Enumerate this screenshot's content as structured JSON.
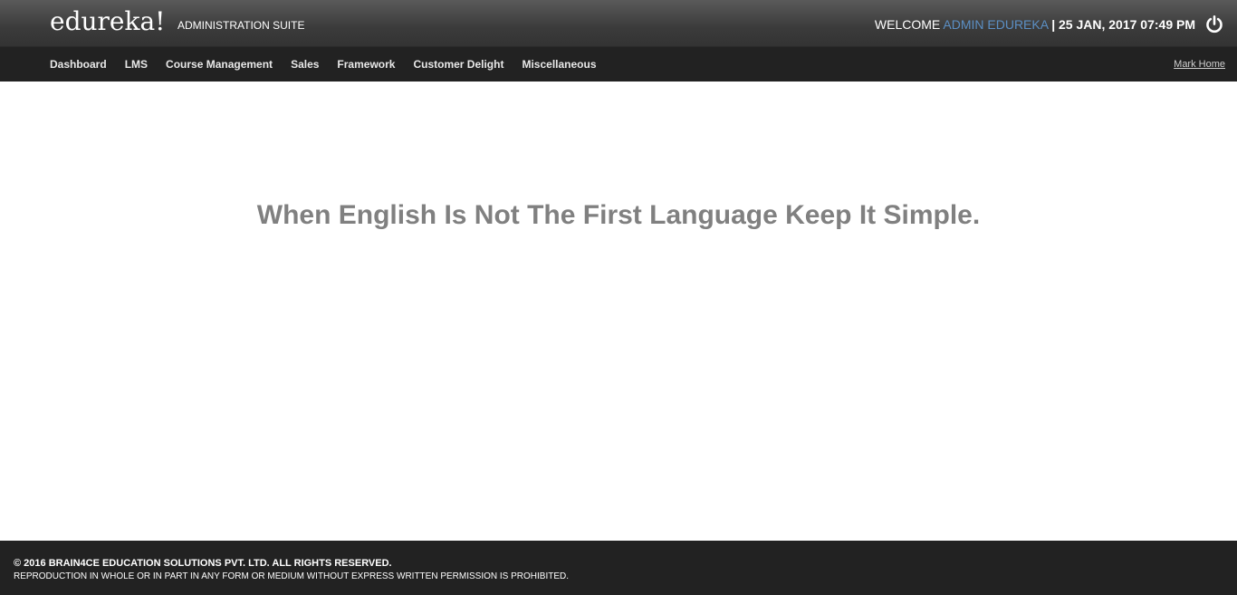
{
  "header": {
    "logo": "edureka!",
    "suite": "ADMINISTRATION SUITE",
    "welcome_label": "WELCOME",
    "user": "ADMIN EDUREKA",
    "datetime": "| 25 JAN, 2017 07:49 PM",
    "power_icon": "power-icon"
  },
  "nav": {
    "items": [
      {
        "label": "Dashboard"
      },
      {
        "label": "LMS"
      },
      {
        "label": "Course Management"
      },
      {
        "label": "Sales"
      },
      {
        "label": "Framework"
      },
      {
        "label": "Customer Delight"
      },
      {
        "label": "Miscellaneous"
      }
    ],
    "mark_home": "Mark Home"
  },
  "main": {
    "headline": "When English Is Not The First Language Keep It Simple."
  },
  "footer": {
    "copyright": "© 2016 BRAIN4CE EDUCATION SOLUTIONS PVT. LTD. ALL RIGHTS RESERVED.",
    "reproduction": "REPRODUCTION IN WHOLE OR IN PART IN ANY FORM OR MEDIUM WITHOUT EXPRESS WRITTEN PERMISSION IS PROHIBITED."
  },
  "colors": {
    "header_bg": "#3b3b3b",
    "nav_bg": "#222222",
    "user_accent": "#5b8fc4",
    "headline": "#808080"
  }
}
